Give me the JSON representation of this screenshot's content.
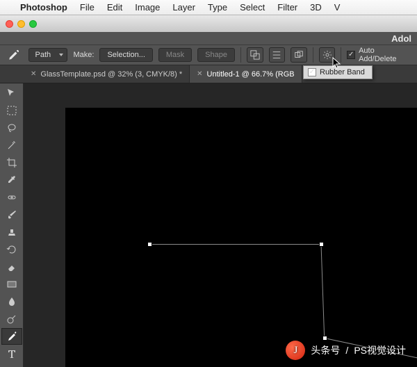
{
  "menu": {
    "app": "Photoshop",
    "items": [
      "File",
      "Edit",
      "Image",
      "Layer",
      "Type",
      "Select",
      "Filter",
      "3D",
      "V"
    ]
  },
  "title_suffix": "Adol",
  "options": {
    "mode": "Path",
    "make_label": "Make:",
    "selection": "Selection...",
    "mask": "Mask",
    "shape": "Shape",
    "auto_add_delete": "Auto Add/Delete"
  },
  "tabs": [
    {
      "label": "GlassTemplate.psd @ 32% (3, CMYK/8) *",
      "active": false
    },
    {
      "label": "Untitled-1 @ 66.7% (RGB",
      "active": true
    }
  ],
  "flyout": {
    "label": "Rubber Band"
  },
  "watermark": {
    "source": "头条号",
    "name": "PS视觉设计"
  }
}
